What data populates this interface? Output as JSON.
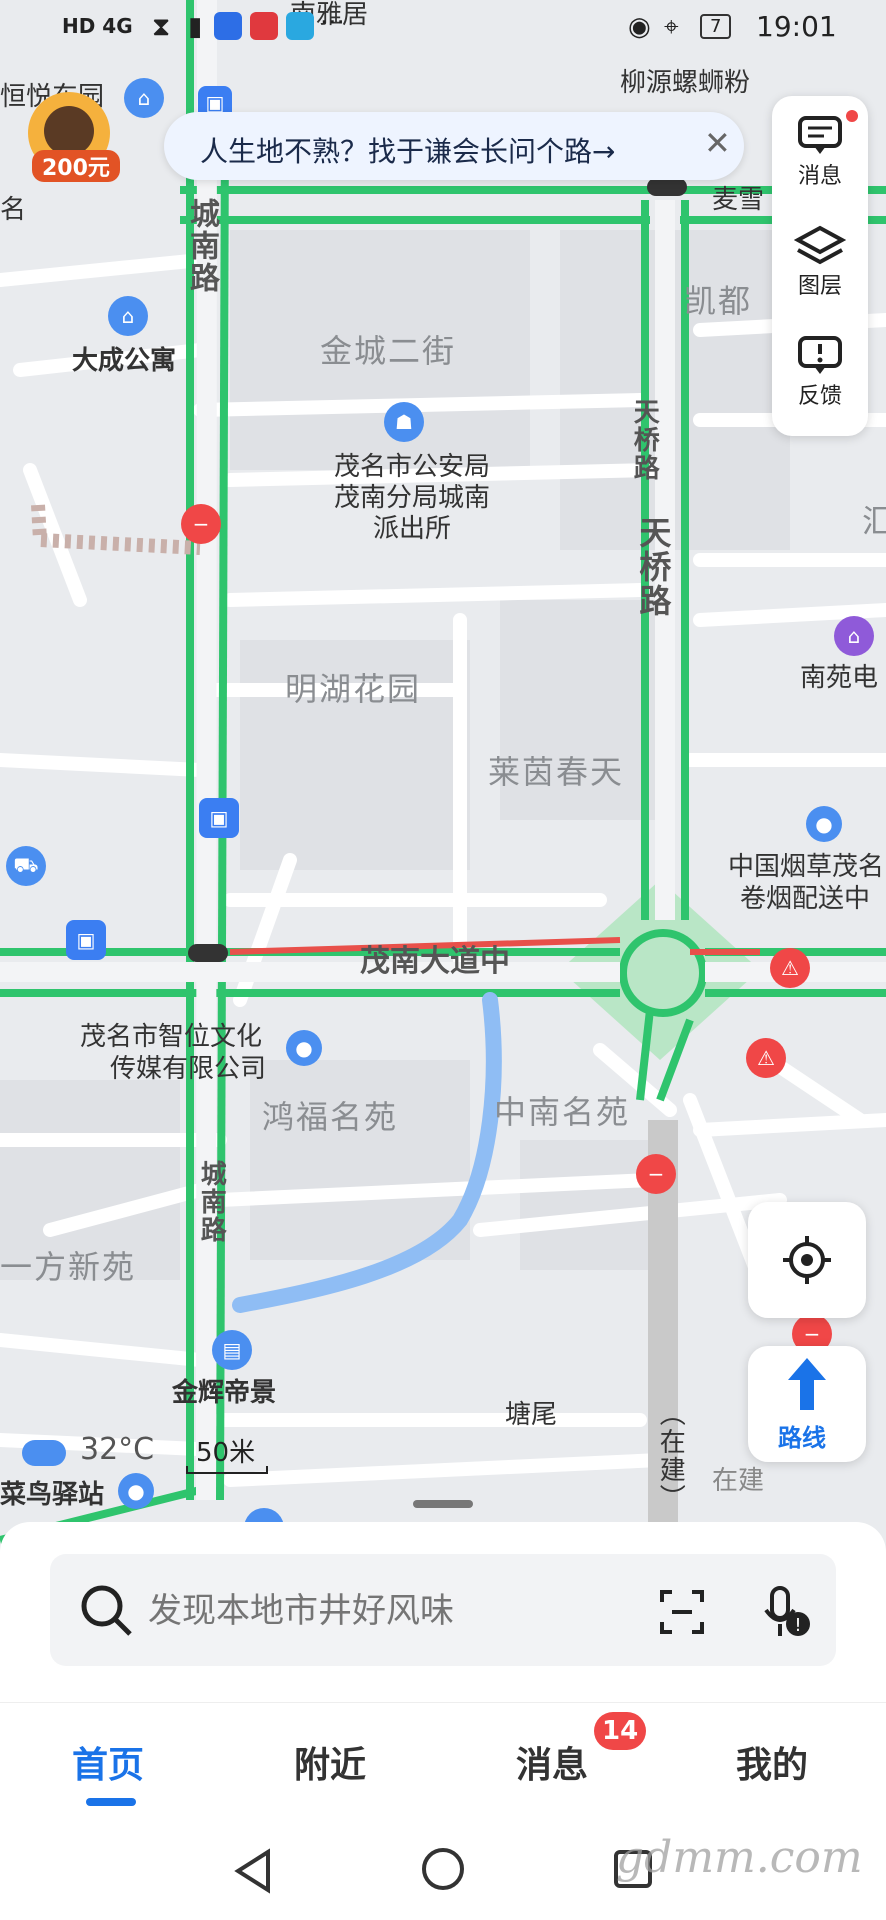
{
  "status_bar": {
    "left_badges": "HD 4G",
    "battery": "7",
    "time": "19:01"
  },
  "promo": {
    "amount": "200元"
  },
  "banner": {
    "text": "人生地不熟？找于谦会长问个路→"
  },
  "side_panel": {
    "messages": "消息",
    "layers": "图层",
    "feedback": "反馈"
  },
  "map_labels": {
    "top_name": "南雅居",
    "luosifen": "柳源螺蛳粉",
    "hengyue": "恒悦东园",
    "ming": "名",
    "maixue": "麦雪",
    "kaidu": "凯都",
    "chengnan1": "城南路",
    "dacheng": "大成公寓",
    "jincheng": "金城二街",
    "police": "茂名市公安局茂南分局城南派出所",
    "tianqiao1": "天桥路",
    "tianqiao2": "天桥路",
    "minghu": "明湖花园",
    "laiyin": "莱茵春天",
    "nanyuan": "南苑电",
    "tobacco1": "中国烟草茂名",
    "tobacco2": "卷烟配送中",
    "maonan": "茂南大道中",
    "zhiwei1": "茂名市智位文化",
    "zhiwei2": "传媒有限公司",
    "hongfu": "鸿福名苑",
    "zhongnan": "中南名苑",
    "chengnan2": "城南路",
    "yifang": "一方新苑",
    "jinhui": "金辉帝景",
    "tangwei": "塘尾",
    "zaijian1": "（在建）",
    "zaijian2": "在建",
    "cainiao": "菜鸟驿站",
    "right_edge": "汇"
  },
  "weather": {
    "temp": "32°C"
  },
  "scale": {
    "text": "50米"
  },
  "route_button": {
    "label": "路线"
  },
  "search": {
    "placeholder": "发现本地市井好风味"
  },
  "tabs": {
    "home": "首页",
    "nearby": "附近",
    "messages": "消息",
    "mine": "我的",
    "messages_badge": "14"
  },
  "watermark": "gdmm.com",
  "colors": {
    "accent": "#1a73e8",
    "road_green": "#2fc46d",
    "road_red": "#e8504a",
    "water": "#8fbdf4"
  }
}
